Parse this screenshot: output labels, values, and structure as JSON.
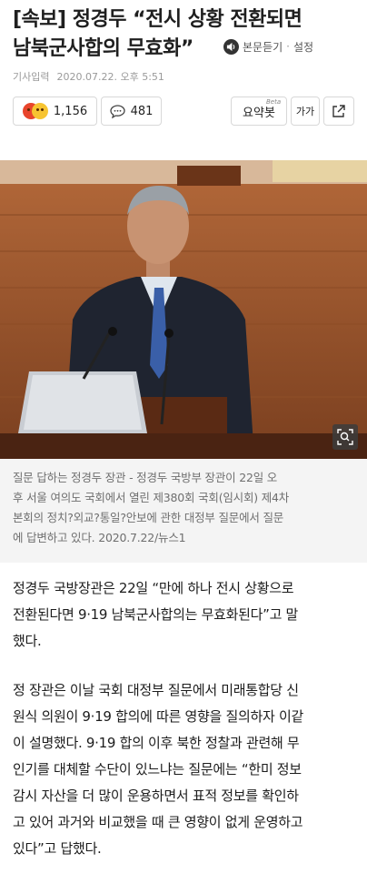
{
  "article": {
    "headline_line1": "[속보] 정경두 “전시 상황 전환되면",
    "headline_line2": "남북군사합의 무효화”",
    "listen_label": "본문듣기",
    "settings_label": "설정",
    "meta_label": "기사입력",
    "meta_date": "2020.07.22. 오후 5:51"
  },
  "toolbar": {
    "reaction_count": "1,156",
    "comment_count": "481",
    "summary_label": "요약봇",
    "summary_badge": "Beta",
    "font_label": "가가",
    "icons": [
      "angry-emoji",
      "laugh-emoji",
      "comment-icon",
      "share-icon",
      "speaker-icon",
      "zoom-icon"
    ]
  },
  "photo": {
    "caption_lines": [
      "질문 답하는 정경두 장관 - 정경두 국방부 장관이 22일 오",
      "후 서울 여의도 국회에서 열린 제380회 국회(임시회) 제4차",
      "본회의 정치?외교?통일?안보에 관한 대정부 질문에서 질문",
      "에 답변하고 있다. 2020.7.22/뉴스1"
    ]
  },
  "body": {
    "p1": [
      "정경두 국방장관은 22일 “만에 하나 전시 상황으로",
      "전환된다면 9·19 남북군사합의는 무효화된다”고 말",
      "했다."
    ],
    "p2": [
      "정 장관은 이날 국회 대정부 질문에서 미래통합당 신",
      "원식 의원이 9·19 합의에 따른 영향을 질의하자 이같",
      "이 설명했다. 9·19 합의 이후 북한 정찰과 관련해 무",
      "인기를 대체할 수단이 있느냐는 질문에는 “한미 정보",
      "감시 자산을 더 많이 운용하면서 표적 정보를 확인하",
      "고 있어 과거와 비교했을 때 큰 영향이 없게 운영하고",
      "있다”고 답했다."
    ]
  }
}
